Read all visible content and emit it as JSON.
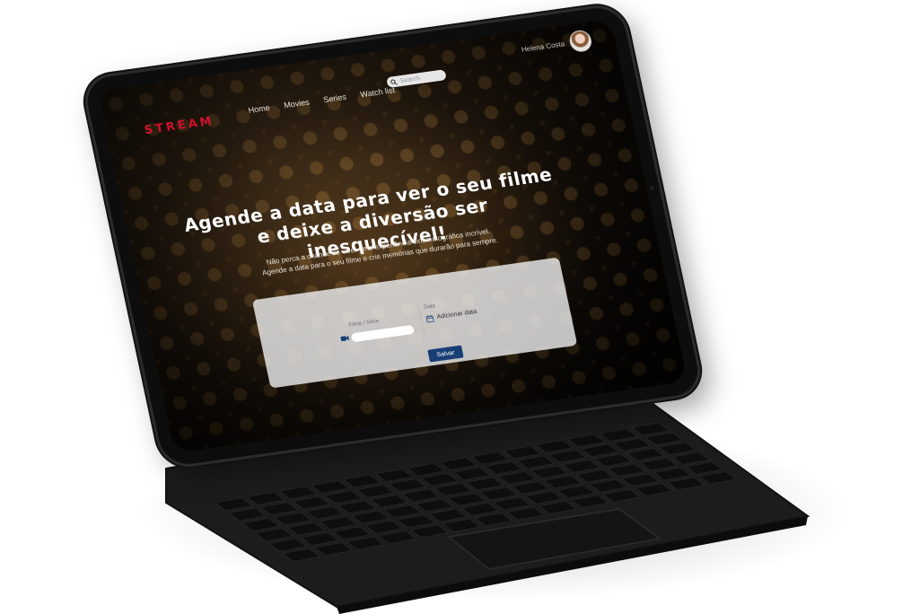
{
  "app": {
    "logo": "STREAM"
  },
  "nav": {
    "items": [
      "Home",
      "Movies",
      "Series",
      "Watch list"
    ],
    "search_placeholder": "Search"
  },
  "user": {
    "name": "Helena Costa"
  },
  "hero": {
    "title_line1": "Agende a data para ver o seu filme",
    "title_line2": "e deixe a diversão ser inesquecível!",
    "subtitle_line1": "Não perca a chance de viver uma experiência cinematográfica incrível.",
    "subtitle_line2": "Agende a data para o seu filme e crie memórias que durarão para sempre."
  },
  "form": {
    "film_label": "Filme / Série",
    "date_label": "Data",
    "date_placeholder": "Adicionar data",
    "save_label": "Salvar"
  },
  "colors": {
    "brand": "#d0102a",
    "button": "#183e76"
  },
  "icons": {
    "search": "search-icon",
    "camera": "video-camera-icon",
    "calendar": "calendar-icon"
  }
}
